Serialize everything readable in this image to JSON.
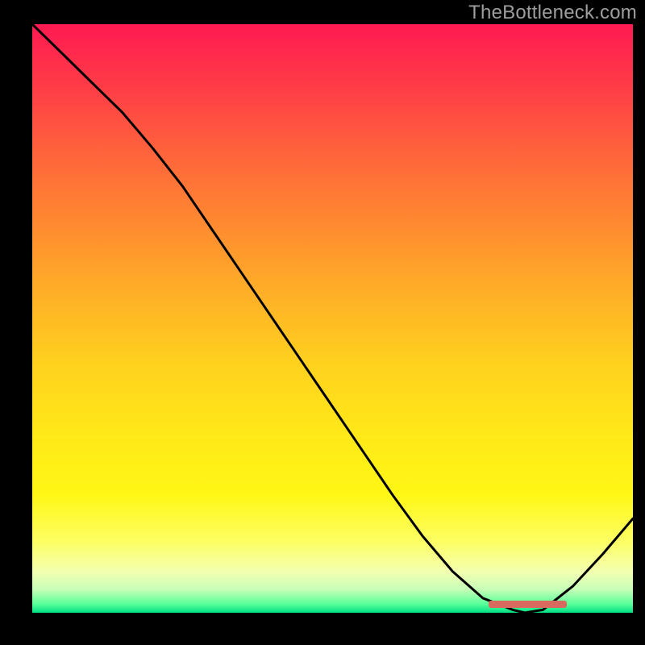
{
  "watermark": "TheBottleneck.com",
  "colors": {
    "line": "#000000",
    "marker": "#d96a60",
    "gradient_top": "#ff1a52",
    "gradient_bottom": "#00e085"
  },
  "chart_data": {
    "type": "line",
    "title": "",
    "xlabel": "",
    "ylabel": "",
    "xlim": [
      0,
      100
    ],
    "ylim": [
      0,
      100
    ],
    "x": [
      0,
      5,
      10,
      15,
      20,
      25,
      30,
      35,
      40,
      45,
      50,
      55,
      60,
      65,
      70,
      75,
      80,
      82,
      85,
      90,
      95,
      100
    ],
    "values": [
      100,
      95,
      90,
      85,
      79,
      72.5,
      65,
      57.5,
      50,
      42.5,
      35,
      27.5,
      20,
      13,
      7,
      2.5,
      0.5,
      0,
      0.5,
      4.5,
      10,
      16
    ],
    "marker_range_x": [
      76,
      89
    ],
    "gradient_stops": [
      {
        "pos": 0.0,
        "color": "#ff1a52"
      },
      {
        "pos": 0.5,
        "color": "#ffc020"
      },
      {
        "pos": 0.9,
        "color": "#fdff65"
      },
      {
        "pos": 1.0,
        "color": "#00e085"
      }
    ]
  }
}
